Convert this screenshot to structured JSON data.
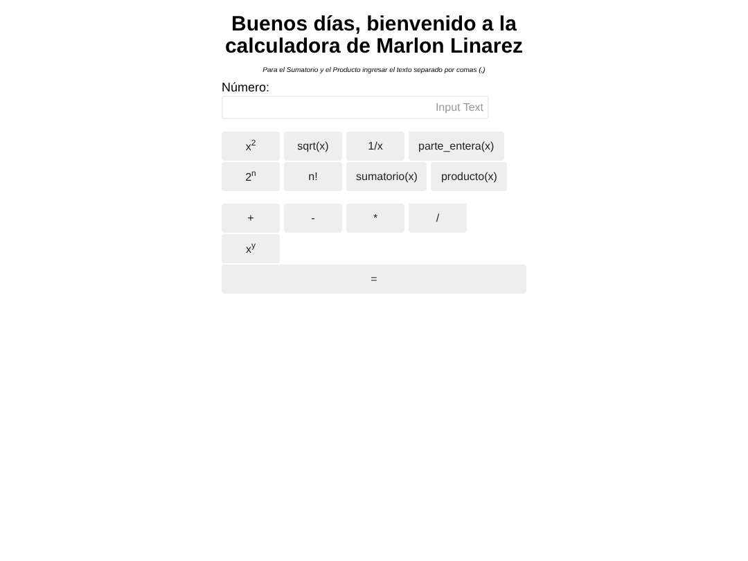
{
  "title": "Buenos días, bienvenido a la calculadora de Marlon Linarez",
  "note": "Para el Sumatorio y el Producto ingresar el texto separado por comas (,)",
  "input": {
    "label": "Número:",
    "placeholder": "Input Text"
  },
  "button_groups": [
    [
      [
        "x$^{2}$",
        "sqrt(x)",
        "1/x",
        "parte_entera(x)"
      ],
      [
        "2$^{n}$",
        "n!",
        "sumatorio(x)",
        "producto(x)"
      ]
    ],
    [
      [
        "+",
        "-",
        "*",
        "/"
      ],
      [
        "x$^{y}$"
      ]
    ]
  ],
  "equals": "="
}
